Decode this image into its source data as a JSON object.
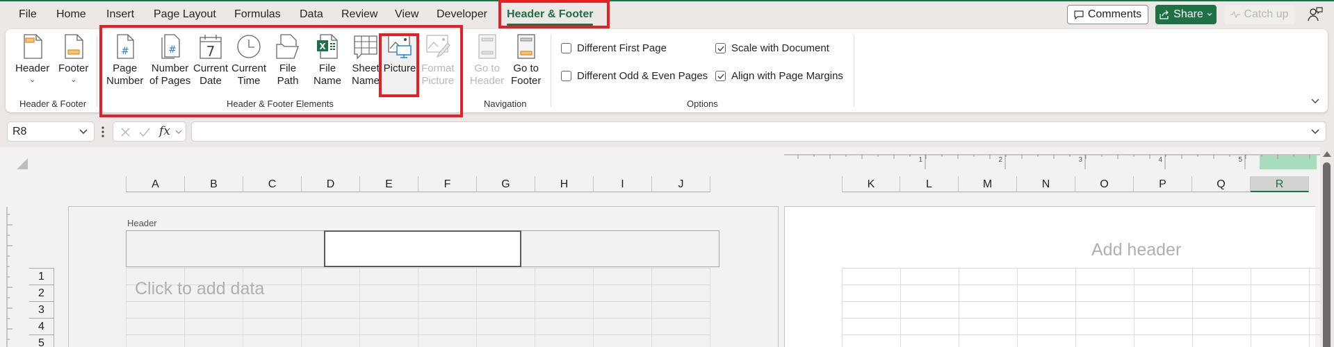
{
  "menu_tabs": [
    "File",
    "Home",
    "Insert",
    "Page Layout",
    "Formulas",
    "Data",
    "Review",
    "View",
    "Developer",
    "Header & Footer"
  ],
  "active_tab": "Header & Footer",
  "top_buttons": {
    "comments": "Comments",
    "share": "Share",
    "catch_up": "Catch up"
  },
  "ribbon": {
    "groups": {
      "header_footer": {
        "label": "Header & Footer",
        "buttons": [
          {
            "label": "Header",
            "icon": "header-page-icon"
          },
          {
            "label": "Footer",
            "icon": "footer-page-icon"
          }
        ]
      },
      "elements": {
        "label": "Header & Footer Elements",
        "buttons": [
          {
            "line1": "Page",
            "line2": "Number",
            "icon": "page-number-icon"
          },
          {
            "line1": "Number",
            "line2": "of Pages",
            "icon": "number-of-pages-icon"
          },
          {
            "line1": "Current",
            "line2": "Date",
            "icon": "calendar-icon",
            "calendar_day": "7"
          },
          {
            "line1": "Current",
            "line2": "Time",
            "icon": "clock-icon"
          },
          {
            "line1": "File",
            "line2": "Path",
            "icon": "folder-icon"
          },
          {
            "line1": "File",
            "line2": "Name",
            "icon": "excel-file-icon"
          },
          {
            "line1": "Sheet",
            "line2": "Name",
            "icon": "sheet-grid-icon"
          },
          {
            "line1": "Picture",
            "line2": "",
            "icon": "picture-icon"
          },
          {
            "line1": "Format",
            "line2": "Picture",
            "icon": "format-picture-icon",
            "disabled": true
          }
        ]
      },
      "navigation": {
        "label": "Navigation",
        "buttons": [
          {
            "line1": "Go to",
            "line2": "Header",
            "icon": "go-to-header-icon",
            "disabled": true
          },
          {
            "line1": "Go to",
            "line2": "Footer",
            "icon": "go-to-footer-icon"
          }
        ]
      },
      "options": {
        "label": "Options",
        "checkboxes": [
          {
            "label": "Different First Page",
            "checked": false
          },
          {
            "label": "Different Odd & Even Pages",
            "checked": false
          },
          {
            "label": "Scale with Document",
            "checked": true
          },
          {
            "label": "Align with Page Margins",
            "checked": true
          }
        ]
      }
    }
  },
  "formula_bar": {
    "name_box": "R8",
    "fx_label": "fx",
    "formula_value": ""
  },
  "sheet": {
    "columns_page1": [
      "A",
      "B",
      "C",
      "D",
      "E",
      "F",
      "G",
      "H",
      "I",
      "J"
    ],
    "columns_page2": [
      "K",
      "L",
      "M",
      "N",
      "O",
      "P",
      "Q",
      "R"
    ],
    "selected_column": "R",
    "rows": [
      "1",
      "2",
      "3",
      "4",
      "5"
    ],
    "ruler_numbers": [
      "1",
      "2",
      "3",
      "4",
      "5"
    ],
    "header_label": "Header",
    "page1_placeholder": "Click to add data",
    "page2_placeholder": "Add header"
  },
  "colors": {
    "accent": "#1e7145",
    "highlight_box": "#e61e26"
  }
}
